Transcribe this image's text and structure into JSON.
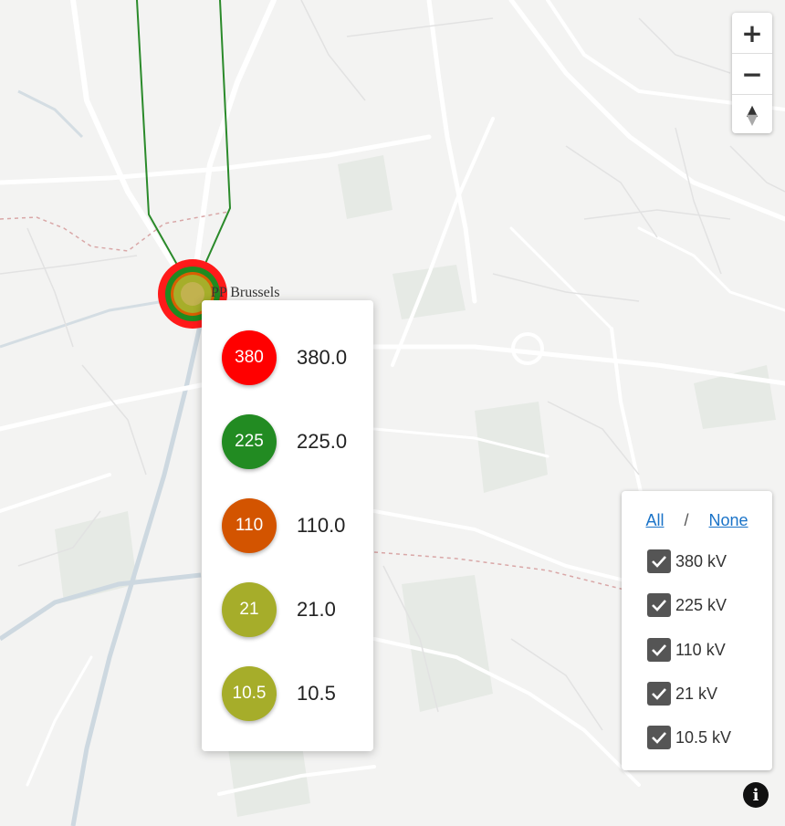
{
  "map": {
    "colors": {
      "background": "#f3f3f2",
      "road": "#ffffff",
      "water": "#c9d6df",
      "park": "#e4e8e3",
      "border": "#d9a7a7",
      "line": "#2a8a2a"
    }
  },
  "zoom_controls": {
    "zoom_in": "+",
    "zoom_out": "−",
    "compass_north": "▲",
    "compass_south": "▼"
  },
  "station": {
    "label": "PP  Brussels",
    "ring_colors": [
      "#ff1a1a",
      "#208a20",
      "#d95f02",
      "#a6ae2a"
    ]
  },
  "popup": {
    "rows": [
      {
        "badge": "380",
        "value": "380.0",
        "color": "#ff0000"
      },
      {
        "badge": "225",
        "value": "225.0",
        "color": "#228b22"
      },
      {
        "badge": "110",
        "value": "110.0",
        "color": "#d35400"
      },
      {
        "badge": "21",
        "value": "21.0",
        "color": "#a6ad2a"
      },
      {
        "badge": "10.5",
        "value": "10.5",
        "color": "#a6ad2a"
      }
    ]
  },
  "legend": {
    "all_label": "All",
    "separator": "/",
    "none_label": "None",
    "items": [
      {
        "label": "380 kV",
        "checked": true
      },
      {
        "label": "225 kV",
        "checked": true
      },
      {
        "label": "110 kV",
        "checked": true
      },
      {
        "label": "21 kV",
        "checked": true
      },
      {
        "label": "10.5 kV",
        "checked": true
      }
    ]
  },
  "info_button": {
    "glyph": "i"
  }
}
